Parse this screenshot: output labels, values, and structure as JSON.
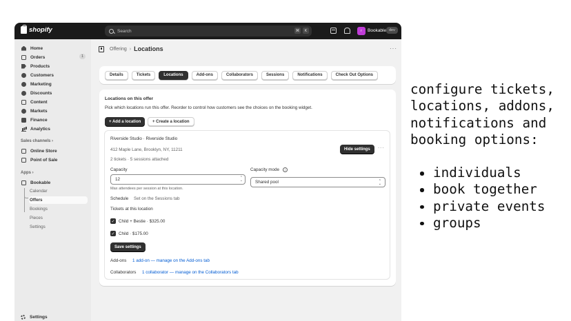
{
  "topbar": {
    "brand": "shopify",
    "search_placeholder": "Search",
    "shortcut_keys": [
      "⌘",
      "K"
    ],
    "avatar_initial": "r",
    "store_name": "Bookable",
    "env_badge": "dev"
  },
  "sidebar": {
    "items": [
      {
        "label": "Home",
        "icon": "home-icon"
      },
      {
        "label": "Orders",
        "icon": "orders-icon",
        "badge": "1"
      },
      {
        "label": "Products",
        "icon": "tag-icon"
      },
      {
        "label": "Customers",
        "icon": "person-icon"
      },
      {
        "label": "Marketing",
        "icon": "target-icon"
      },
      {
        "label": "Discounts",
        "icon": "discount-icon"
      },
      {
        "label": "Content",
        "icon": "content-icon"
      },
      {
        "label": "Markets",
        "icon": "globe-icon"
      },
      {
        "label": "Finance",
        "icon": "bank-icon"
      },
      {
        "label": "Analytics",
        "icon": "bar-chart-icon"
      }
    ],
    "sales_channels_label": "Sales channels",
    "channels": [
      {
        "label": "Online Store",
        "icon": "store-icon"
      },
      {
        "label": "Point of Sale",
        "icon": "pos-icon"
      }
    ],
    "apps_label": "Apps",
    "app_name": "Bookable",
    "app_subitems": [
      "Calendar",
      "Offers",
      "Bookings",
      "Pieces",
      "Settings"
    ],
    "settings_label": "Settings"
  },
  "breadcrumb": {
    "parent": "Offering",
    "current": "Locations",
    "more": "···"
  },
  "tabs": [
    "Details",
    "Tickets",
    "Locations",
    "Add-ons",
    "Collaborators",
    "Sessions",
    "Notifications",
    "Check Out Options"
  ],
  "active_tab": "Locations",
  "locations": {
    "title": "Locations on this offer",
    "description": "Pick which locations run this offer. Reorder to control how customers see the choices on the booking widget.",
    "add_button": "+ Add a location",
    "create_button": "+ Create a location",
    "location": {
      "name": "Riverside Studio · Riverside Studio",
      "address": "412 Maple Lane, Brooklyn, NY, 11211",
      "summary": "2 tickets · 5 sessions attached",
      "hide_settings": "Hide settings",
      "more": "···",
      "capacity_label": "Capacity",
      "capacity_value": "12",
      "capacity_help": "Max attendees per session at this location.",
      "capacity_mode_label": "Capacity mode",
      "capacity_mode_value": "Shared pool",
      "schedule_label": "Schedule",
      "schedule_value": "Set on the Sessions tab",
      "tickets_label": "Tickets at this location",
      "tickets": [
        {
          "label": "Child + Bestie · $325.00",
          "checked": true
        },
        {
          "label": "Child · $175.00",
          "checked": true
        }
      ],
      "save_button": "Save settings",
      "addons_label": "Add-ons",
      "addons_link": "1 add-on — manage on the Add-ons tab",
      "collaborators_label": "Collaborators",
      "collaborators_link": "1 collaborator — manage on the Collaborators tab"
    }
  },
  "side": {
    "intro": "configure tickets, locations, addons, notifications and booking options:",
    "bullets": [
      "individuals",
      "book together",
      "private events",
      "groups"
    ]
  }
}
